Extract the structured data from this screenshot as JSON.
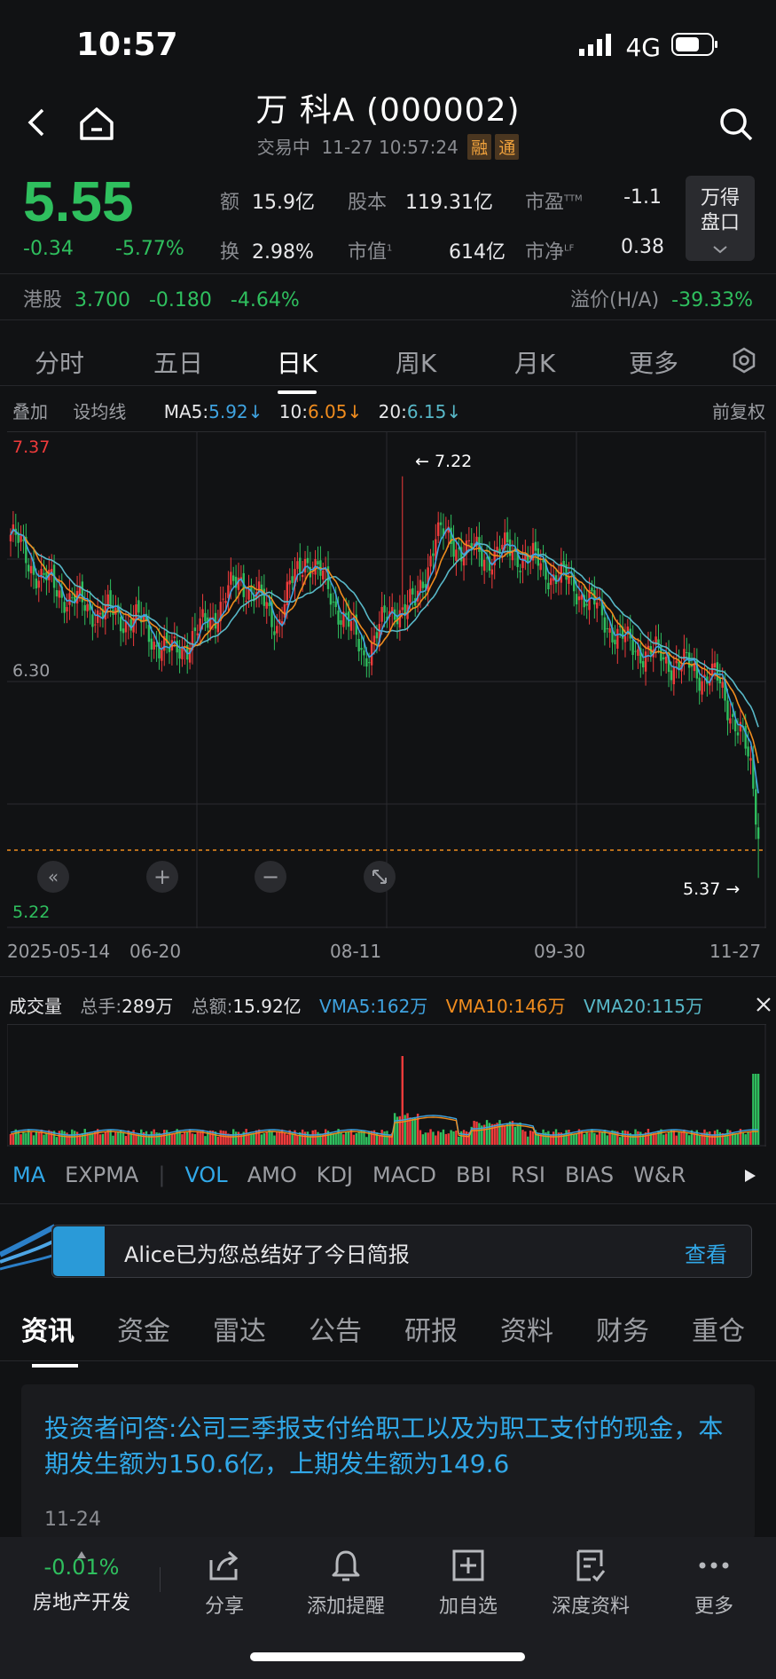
{
  "status": {
    "time": "10:57",
    "network": "4G"
  },
  "header": {
    "title": "万 科A (000002)",
    "status": "交易中",
    "datetime": "11-27 10:57:24",
    "tag1": "融",
    "tag2": "通"
  },
  "quote": {
    "price": "5.55",
    "change": "-0.34",
    "change_pct": "-5.77%",
    "stats": [
      {
        "k": "额",
        "v": "15.9亿"
      },
      {
        "k": "股本",
        "v": "119.31亿"
      },
      {
        "k": "市盈",
        "sup": "TTM",
        "v": "-1.1"
      },
      {
        "k": "换",
        "v": "2.98%"
      },
      {
        "k": "市值",
        "sup": "1",
        "v": "614亿"
      },
      {
        "k": "市净",
        "sup": "LF",
        "v": "0.38"
      }
    ],
    "wande_line1": "万得",
    "wande_line2": "盘口"
  },
  "hk": {
    "label": "港股",
    "price": "3.700",
    "change": "-0.180",
    "pct": "-4.64%",
    "premium_label": "溢价(H/A)",
    "premium": "-39.33%"
  },
  "ktabs": [
    "分时",
    "五日",
    "日K",
    "周K",
    "月K",
    "更多"
  ],
  "ma": {
    "overlay": "叠加",
    "setting": "设均线",
    "ma5_label": "MA5:",
    "ma5": "5.92",
    "ma10_label": "10:",
    "ma10": "6.05",
    "ma20_label": "20:",
    "ma20": "6.15",
    "adjust": "前复权"
  },
  "chart": {
    "high_label": "7.37",
    "mid_label": "6.30",
    "low_label": "5.22",
    "max_annot": "7.22",
    "min_annot": "5.37",
    "dates": [
      "2025-05-14",
      "06-20",
      "08-11",
      "09-30",
      "11-27"
    ]
  },
  "volume": {
    "label": "成交量",
    "total_hands_label": "总手:",
    "total_hands": "289万",
    "total_amt_label": "总额:",
    "total_amt": "15.92亿",
    "vma5": "VMA5:162万",
    "vma10": "VMA10:146万",
    "vma20": "VMA20:115万"
  },
  "indicators": [
    "MA",
    "EXPMA",
    "VOL",
    "AMO",
    "KDJ",
    "MACD",
    "BBI",
    "RSI",
    "BIAS",
    "W&R"
  ],
  "alice": {
    "text": "Alice已为您总结好了今日简报",
    "button": "查看"
  },
  "news_tabs": [
    "资讯",
    "资金",
    "雷达",
    "公告",
    "研报",
    "资料",
    "财务",
    "重仓"
  ],
  "news": {
    "title": "投资者问答:公司三季报支付给职工以及为职工支付的现金，本期发生额为150.6亿，上期发生额为149.6",
    "date": "11-24"
  },
  "bottom": {
    "sector_pct": "-0.01%",
    "sector_name": "房地产开发",
    "share": "分享",
    "alert": "添加提醒",
    "watch": "加自选",
    "deep": "深度资料",
    "more": "更多"
  },
  "colors": {
    "up": "#ef3b3b",
    "down": "#2fbf5e",
    "link": "#31a8e8",
    "ma5": "#3fa3e0",
    "ma10": "#f08c1e",
    "ma20": "#58b8c8"
  }
}
